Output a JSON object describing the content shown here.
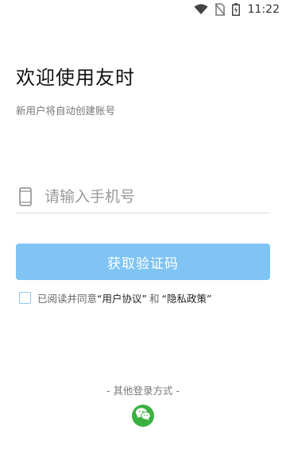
{
  "status_bar": {
    "time": "11:22"
  },
  "welcome": {
    "title": "欢迎使用友时",
    "subtitle": "新用户将自动创建账号"
  },
  "phone": {
    "placeholder": "请输入手机号",
    "value": ""
  },
  "code_button": {
    "label": "获取验证码"
  },
  "agreement": {
    "prefix": "已阅读并同意",
    "user_agreement": "“用户协议”",
    "conjunction": "和",
    "privacy_policy": "“隐私政策”",
    "checked": false
  },
  "other_login": {
    "label": "- 其他登录方式 -",
    "wechat_icon": "wechat-icon"
  },
  "colors": {
    "primary_button": "#7fc4f3",
    "wechat": "#3cb13f"
  }
}
